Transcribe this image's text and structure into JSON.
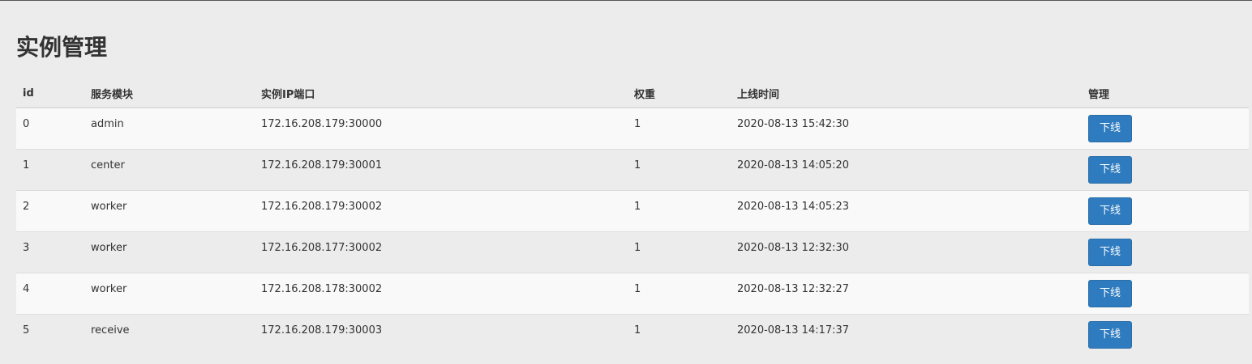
{
  "page": {
    "title": "实例管理"
  },
  "table": {
    "headers": {
      "id": "id",
      "module": "服务模块",
      "ip_port": "实例IP端口",
      "weight": "权重",
      "online_time": "上线时间",
      "manage": "管理"
    },
    "rows": [
      {
        "id": "0",
        "module": "admin",
        "ip_port": "172.16.208.179:30000",
        "weight": "1",
        "online_time": "2020-08-13 15:42:30",
        "action": "下线"
      },
      {
        "id": "1",
        "module": "center",
        "ip_port": "172.16.208.179:30001",
        "weight": "1",
        "online_time": "2020-08-13 14:05:20",
        "action": "下线"
      },
      {
        "id": "2",
        "module": "worker",
        "ip_port": "172.16.208.179:30002",
        "weight": "1",
        "online_time": "2020-08-13 14:05:23",
        "action": "下线"
      },
      {
        "id": "3",
        "module": "worker",
        "ip_port": "172.16.208.177:30002",
        "weight": "1",
        "online_time": "2020-08-13 12:32:30",
        "action": "下线"
      },
      {
        "id": "4",
        "module": "worker",
        "ip_port": "172.16.208.178:30002",
        "weight": "1",
        "online_time": "2020-08-13 12:32:27",
        "action": "下线"
      },
      {
        "id": "5",
        "module": "receive",
        "ip_port": "172.16.208.179:30003",
        "weight": "1",
        "online_time": "2020-08-13 14:17:37",
        "action": "下线"
      }
    ]
  },
  "colors": {
    "button": "#2e7bbf",
    "background": "#ececec",
    "row_stripe": "#f9f9f9"
  }
}
